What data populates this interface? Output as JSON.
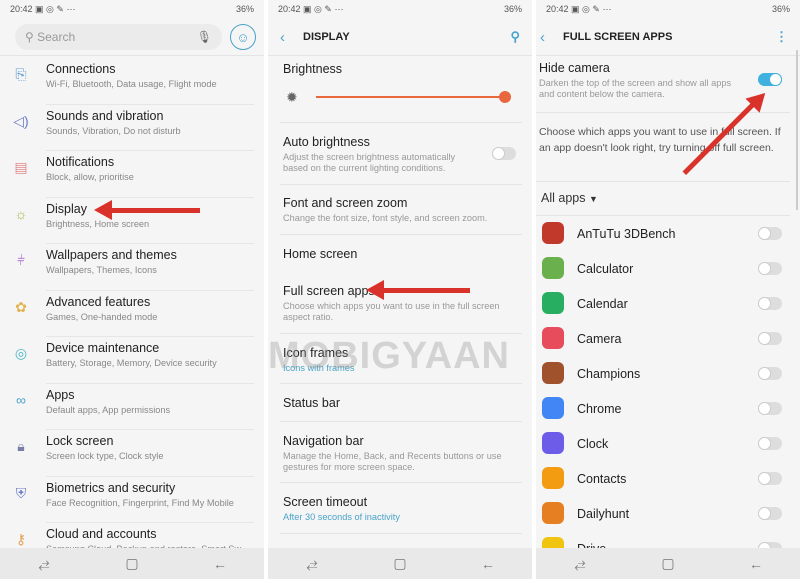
{
  "status": {
    "time": "20:42",
    "icons": "▣ ◎ ✎ ⋯",
    "battery": "36%"
  },
  "settings": {
    "search_placeholder": "Search",
    "items": [
      {
        "title": "Connections",
        "sub": "Wi-Fi, Bluetooth, Data usage, Flight mode",
        "icon": "connections-icon",
        "glyph": "⎘",
        "color": "#5a9bd5"
      },
      {
        "title": "Sounds and vibration",
        "sub": "Sounds, Vibration, Do not disturb",
        "icon": "speaker-icon",
        "glyph": "◁)",
        "color": "#6a7bc9"
      },
      {
        "title": "Notifications",
        "sub": "Block, allow, prioritise",
        "icon": "notifications-icon",
        "glyph": "▤",
        "color": "#e08a8a"
      },
      {
        "title": "Display",
        "sub": "Brightness, Home screen",
        "icon": "display-icon",
        "glyph": "☼",
        "color": "#a3b84a"
      },
      {
        "title": "Wallpapers and themes",
        "sub": "Wallpapers, Themes, Icons",
        "icon": "brush-icon",
        "glyph": "⫩",
        "color": "#9b4fc9"
      },
      {
        "title": "Advanced features",
        "sub": "Games, One-handed mode",
        "icon": "gear-plus-icon",
        "glyph": "✿",
        "color": "#e2b451"
      },
      {
        "title": "Device maintenance",
        "sub": "Battery, Storage, Memory, Device security",
        "icon": "maintenance-icon",
        "glyph": "◎",
        "color": "#4fb6c9"
      },
      {
        "title": "Apps",
        "sub": "Default apps, App permissions",
        "icon": "apps-icon",
        "glyph": "∞",
        "color": "#4fa3c9"
      },
      {
        "title": "Lock screen",
        "sub": "Screen lock type, Clock style",
        "icon": "lock-icon",
        "glyph": "🔒︎",
        "color": "#7a7fa8"
      },
      {
        "title": "Biometrics and security",
        "sub": "Face Recognition, Fingerprint, Find My Mobile",
        "icon": "shield-icon",
        "glyph": "⛨",
        "color": "#6a7bc9"
      },
      {
        "title": "Cloud and accounts",
        "sub": "Samsung Cloud, Backup and restore, Smart Sw...",
        "icon": "key-icon",
        "glyph": "⚷",
        "color": "#e2a051"
      }
    ]
  },
  "display": {
    "title": "DISPLAY",
    "brightness": "Brightness",
    "brightness_level": 1.0,
    "auto_brightness": {
      "title": "Auto brightness",
      "sub": "Adjust the screen brightness automatically based on the current lighting conditions.",
      "on": false
    },
    "font": {
      "title": "Font and screen zoom",
      "sub": "Change the font size, font style, and screen zoom."
    },
    "home": "Home screen",
    "fullscreen": {
      "title": "Full screen apps",
      "sub": "Choose which apps you want to use in the full screen aspect ratio."
    },
    "icon_frames": {
      "title": "Icon frames",
      "sub": "Icons with frames"
    },
    "status_bar": "Status bar",
    "navigation": {
      "title": "Navigation bar",
      "sub": "Manage the Home, Back, and Recents buttons or use gestures for more screen space."
    },
    "timeout": {
      "title": "Screen timeout",
      "sub": "After 30 seconds of inactivity"
    }
  },
  "fullscreen": {
    "title": "FULL SCREEN APPS",
    "hide_camera": {
      "title": "Hide camera",
      "sub": "Darken the top of the screen and show all apps and content below the camera.",
      "on": true
    },
    "info": "Choose which apps you want to use in full screen. If an app doesn't look right, try turning off full screen.",
    "filter": "All apps",
    "apps": [
      {
        "name": "AnTuTu 3DBench",
        "color": "#c0392b"
      },
      {
        "name": "Calculator",
        "color": "#6ab04c"
      },
      {
        "name": "Calendar",
        "color": "#27ae60"
      },
      {
        "name": "Camera",
        "color": "#e74c5c"
      },
      {
        "name": "Champions",
        "color": "#a0522d"
      },
      {
        "name": "Chrome",
        "color": "#4285f4"
      },
      {
        "name": "Clock",
        "color": "#6c5ce7"
      },
      {
        "name": "Contacts",
        "color": "#f39c12"
      },
      {
        "name": "Dailyhunt",
        "color": "#e67e22"
      },
      {
        "name": "Drive",
        "color": "#f1c40f"
      }
    ]
  },
  "watermark": "MOBIGYAAN",
  "nav": {
    "recents": "⥄",
    "home": "▢",
    "back": "←"
  },
  "colors": {
    "accent": "#4aa3c9",
    "arrow": "#d9322b",
    "slider": "#e8673c",
    "toggle_on": "#3fb1de"
  }
}
